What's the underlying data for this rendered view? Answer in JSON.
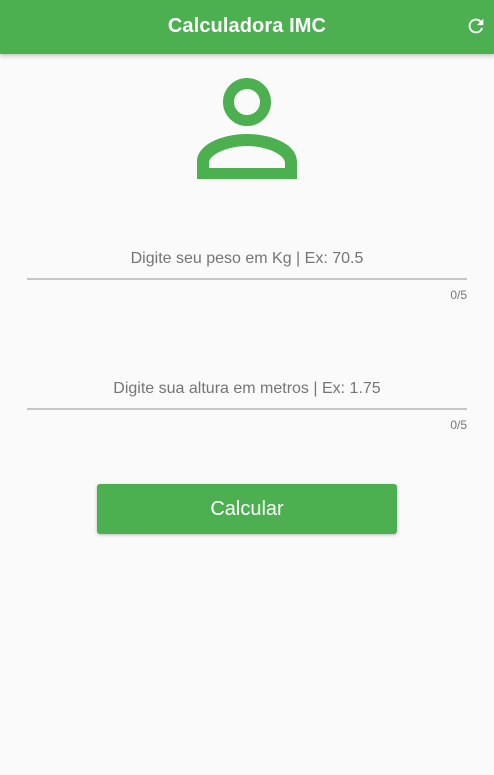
{
  "appbar": {
    "title": "Calculadora IMC",
    "refresh_icon": "refresh-icon",
    "background_color": "#4caf50"
  },
  "header_icon": "person-outline-icon",
  "weight_field": {
    "placeholder": "Digite seu peso em Kg | Ex: 70.5",
    "value": "",
    "counter": "0/5"
  },
  "height_field": {
    "placeholder": "Digite sua altura em metros | Ex: 1.75",
    "value": "",
    "counter": "0/5"
  },
  "calculate_button": {
    "label": "Calcular"
  },
  "colors": {
    "accent": "#4caf50",
    "background": "#fafafa",
    "hint_text": "#757575",
    "underline": "#c6c6c6"
  }
}
